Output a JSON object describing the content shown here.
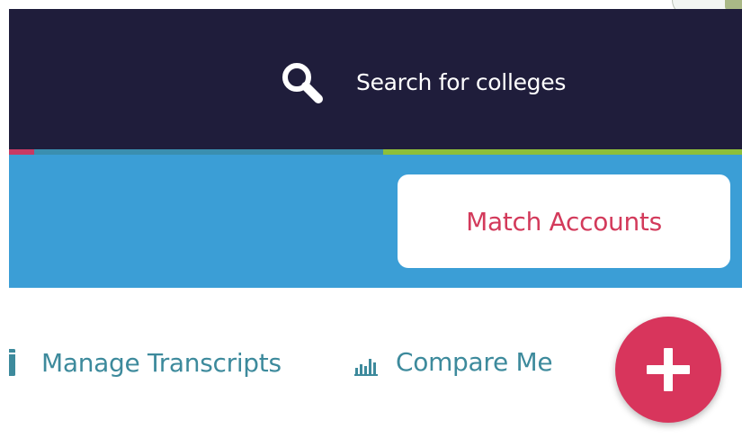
{
  "header": {
    "search_label": "Search for colleges",
    "search_icon": "search-icon",
    "background_color": "#1f1d3b"
  },
  "action_bar": {
    "match_accounts_label": "Match Accounts",
    "background_color": "#3b9ed6",
    "button_text_color": "#d33a5b"
  },
  "subnav": {
    "items": [
      {
        "label": "Manage Transcripts",
        "icon": "document-icon"
      },
      {
        "label": "Compare Me",
        "icon": "bar-chart-icon"
      }
    ],
    "text_color": "#3d8a9c"
  },
  "fab": {
    "icon": "plus-icon",
    "color": "#d8355c"
  }
}
